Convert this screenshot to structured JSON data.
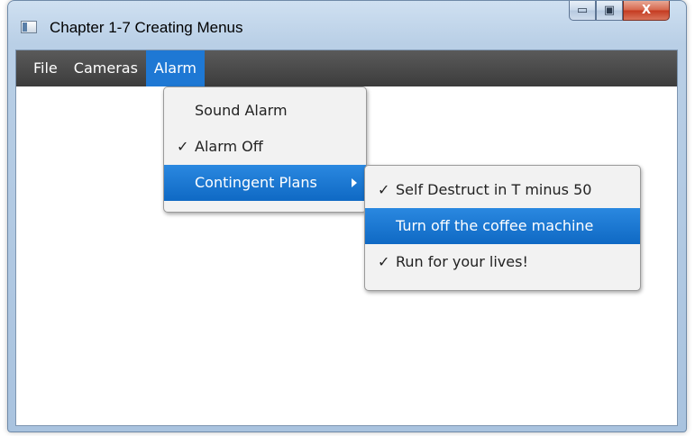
{
  "window": {
    "title": "Chapter 1-7 Creating Menus",
    "buttons": {
      "minimize": "▭",
      "maximize": "▣",
      "close": "X"
    }
  },
  "menubar": {
    "items": [
      {
        "label": "File"
      },
      {
        "label": "Cameras"
      },
      {
        "label": "Alarm"
      }
    ]
  },
  "alarm_menu": {
    "items": [
      {
        "label": "Sound Alarm",
        "checked": false
      },
      {
        "label": "Alarm Off",
        "checked": true,
        "check": "✓"
      },
      {
        "label": "Contingent Plans",
        "has_submenu": true
      }
    ]
  },
  "contingent_submenu": {
    "items": [
      {
        "label": "Self Destruct in T minus 50",
        "checked": true,
        "check": "✓"
      },
      {
        "label": "Turn off the coffee machine",
        "checked": false
      },
      {
        "label": "Run for your lives!",
        "checked": true,
        "check": "✓"
      }
    ]
  },
  "colors": {
    "accent": "#1e78d4",
    "menubar": "#3c3c3c"
  }
}
